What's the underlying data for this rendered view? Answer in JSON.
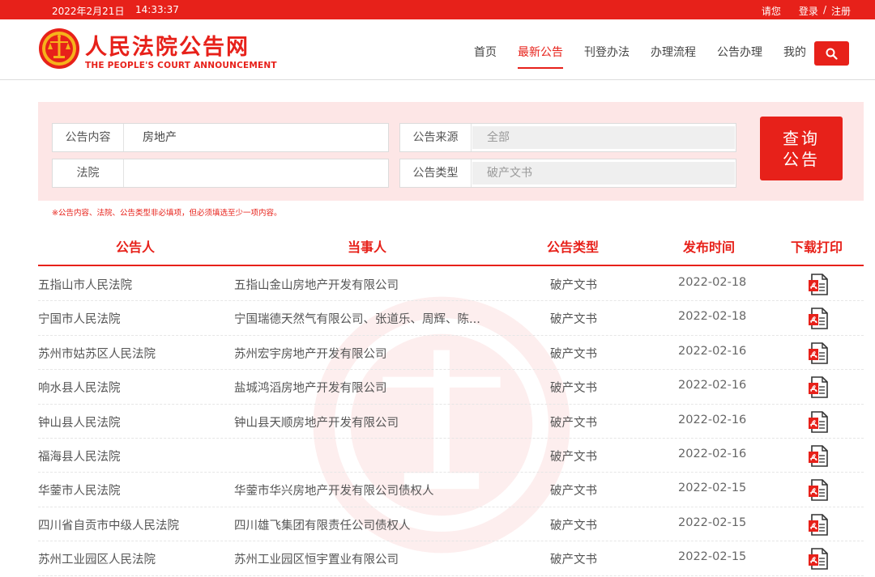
{
  "topbar": {
    "date": "2022年2月21日",
    "time": "14:33:37",
    "please": "请您",
    "login": "登录",
    "sep": "/",
    "register": "注册"
  },
  "header": {
    "title": "人民法院公告网",
    "subtitle": "THE PEOPLE'S COURT ANNOUNCEMENT",
    "logo_icon": "court-emblem-icon",
    "nav": [
      {
        "label": "首页",
        "active": false
      },
      {
        "label": "最新公告",
        "active": true
      },
      {
        "label": "刊登办法",
        "active": false
      },
      {
        "label": "办理流程",
        "active": false
      },
      {
        "label": "公告办理",
        "active": false
      },
      {
        "label": "我的",
        "active": false
      }
    ],
    "search_icon": "search-icon"
  },
  "search": {
    "content_label": "公告内容",
    "content_value": "房地产",
    "court_label": "法院",
    "court_value": "",
    "source_label": "公告来源",
    "source_value": "全部",
    "type_label": "公告类型",
    "type_value": "破产文书",
    "query_line1": "查询",
    "query_line2": "公告",
    "hint": "※公告内容、法院、公告类型非必填项，但必须填选至少一项内容。"
  },
  "table": {
    "headers": [
      "公告人",
      "当事人",
      "公告类型",
      "发布时间",
      "下载打印"
    ],
    "rows": [
      {
        "court": "五指山市人民法院",
        "party": "五指山金山房地产开发有限公司",
        "type": "破产文书",
        "date": "2022-02-18"
      },
      {
        "court": "宁国市人民法院",
        "party": "宁国瑞德天然气有限公司、张道乐、周辉、陈...",
        "type": "破产文书",
        "date": "2022-02-18"
      },
      {
        "court": "苏州市姑苏区人民法院",
        "party": "苏州宏宇房地产开发有限公司",
        "type": "破产文书",
        "date": "2022-02-16"
      },
      {
        "court": "响水县人民法院",
        "party": "盐城鸿滔房地产开发有限公司",
        "type": "破产文书",
        "date": "2022-02-16"
      },
      {
        "court": "钟山县人民法院",
        "party": "钟山县天顺房地产开发有限公司",
        "type": "破产文书",
        "date": "2022-02-16"
      },
      {
        "court": "福海县人民法院",
        "party": "",
        "type": "破产文书",
        "date": "2022-02-16"
      },
      {
        "court": "华蓥市人民法院",
        "party": "华蓥市华兴房地产开发有限公司债权人",
        "type": "破产文书",
        "date": "2022-02-15"
      },
      {
        "court": "四川省自贡市中级人民法院",
        "party": "四川雄飞集团有限责任公司债权人",
        "type": "破产文书",
        "date": "2022-02-15"
      },
      {
        "court": "苏州工业园区人民法院",
        "party": "苏州工业园区恒宇置业有限公司",
        "type": "破产文书",
        "date": "2022-02-15"
      }
    ],
    "download_icon": "pdf-file-icon"
  },
  "colors": {
    "brand": "#e7211a",
    "panel_bg": "#fde6e6"
  }
}
